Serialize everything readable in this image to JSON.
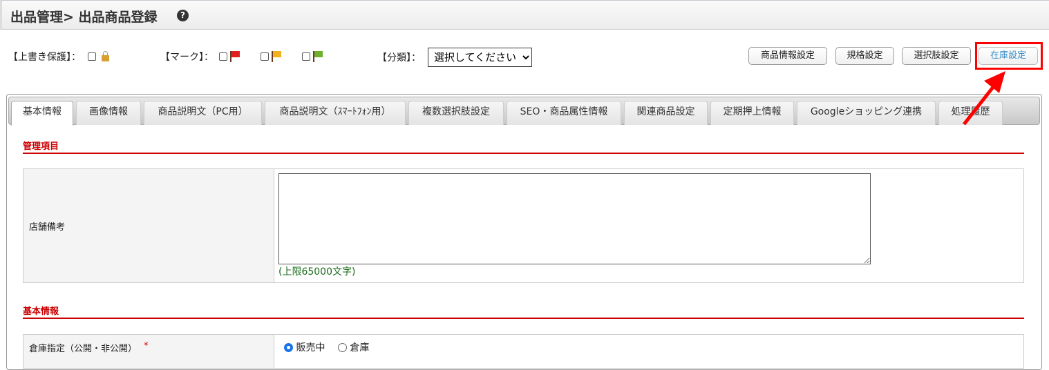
{
  "header": {
    "title": "出品管理> 出品商品登録",
    "help_icon": "?"
  },
  "options": {
    "overwrite_label": "【上書き保護】：",
    "mark_label": "【マーク】：",
    "category_label": "【分類】：",
    "category_value": "選択してください",
    "flags": [
      "#e02020",
      "#f0b020",
      "#70b030"
    ]
  },
  "buttons": [
    "商品情報設定",
    "規格設定",
    "選択肢設定",
    "在庫設定"
  ],
  "tabs": [
    "基本情報",
    "画像情報",
    "商品説明文（PC用）",
    "商品説明文（ｽﾏｰﾄﾌｫﾝ用）",
    "複数選択肢設定",
    "SEO・商品属性情報",
    "関連商品設定",
    "定期押上情報",
    "Googleショッピング連携",
    "処理履歴"
  ],
  "section1": {
    "title": "管理項目",
    "field_label": "店舗備考",
    "textarea_value": "",
    "note": "(上限65000文字)"
  },
  "section2": {
    "title": "基本情報",
    "field_label": "倉庫指定（公開・非公開）",
    "required": "*",
    "radios": [
      {
        "label": "販売中",
        "checked": true
      },
      {
        "label": "倉庫",
        "checked": false
      }
    ]
  }
}
